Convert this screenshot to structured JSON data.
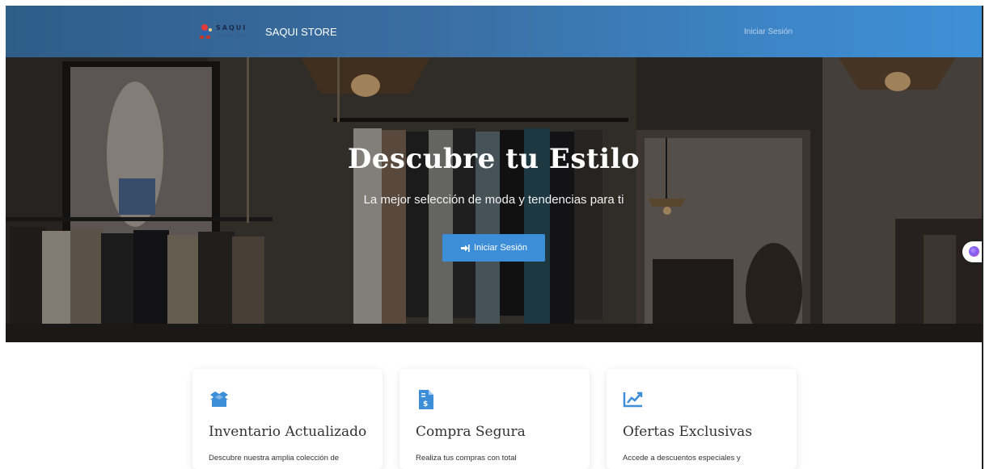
{
  "navbar": {
    "logo_word": "SAQUI",
    "logo_sub": "Ecuador store",
    "brand_name": "SAQUI STORE",
    "login_link": "Iniciar Sesión"
  },
  "hero": {
    "title": "Descubre tu Estilo",
    "subtitle": "La mejor selección de moda y tendencias para ti",
    "button_label": "Iniciar Sesión",
    "button_icon": "sign-in-icon"
  },
  "features": [
    {
      "icon": "box-open-icon",
      "title": "Inventario Actualizado",
      "description": "Descubre nuestra amplia colección de"
    },
    {
      "icon": "invoice-dollar-icon",
      "title": "Compra Segura",
      "description": "Realiza tus compras con total"
    },
    {
      "icon": "chart-line-icon",
      "title": "Ofertas Exclusivas",
      "description": "Accede a descuentos especiales y"
    }
  ],
  "colors": {
    "accent": "#3d8ed8",
    "navbar_start": "#2f5d8a",
    "navbar_end": "#3e90d6",
    "icon": "#3d8ed8"
  }
}
